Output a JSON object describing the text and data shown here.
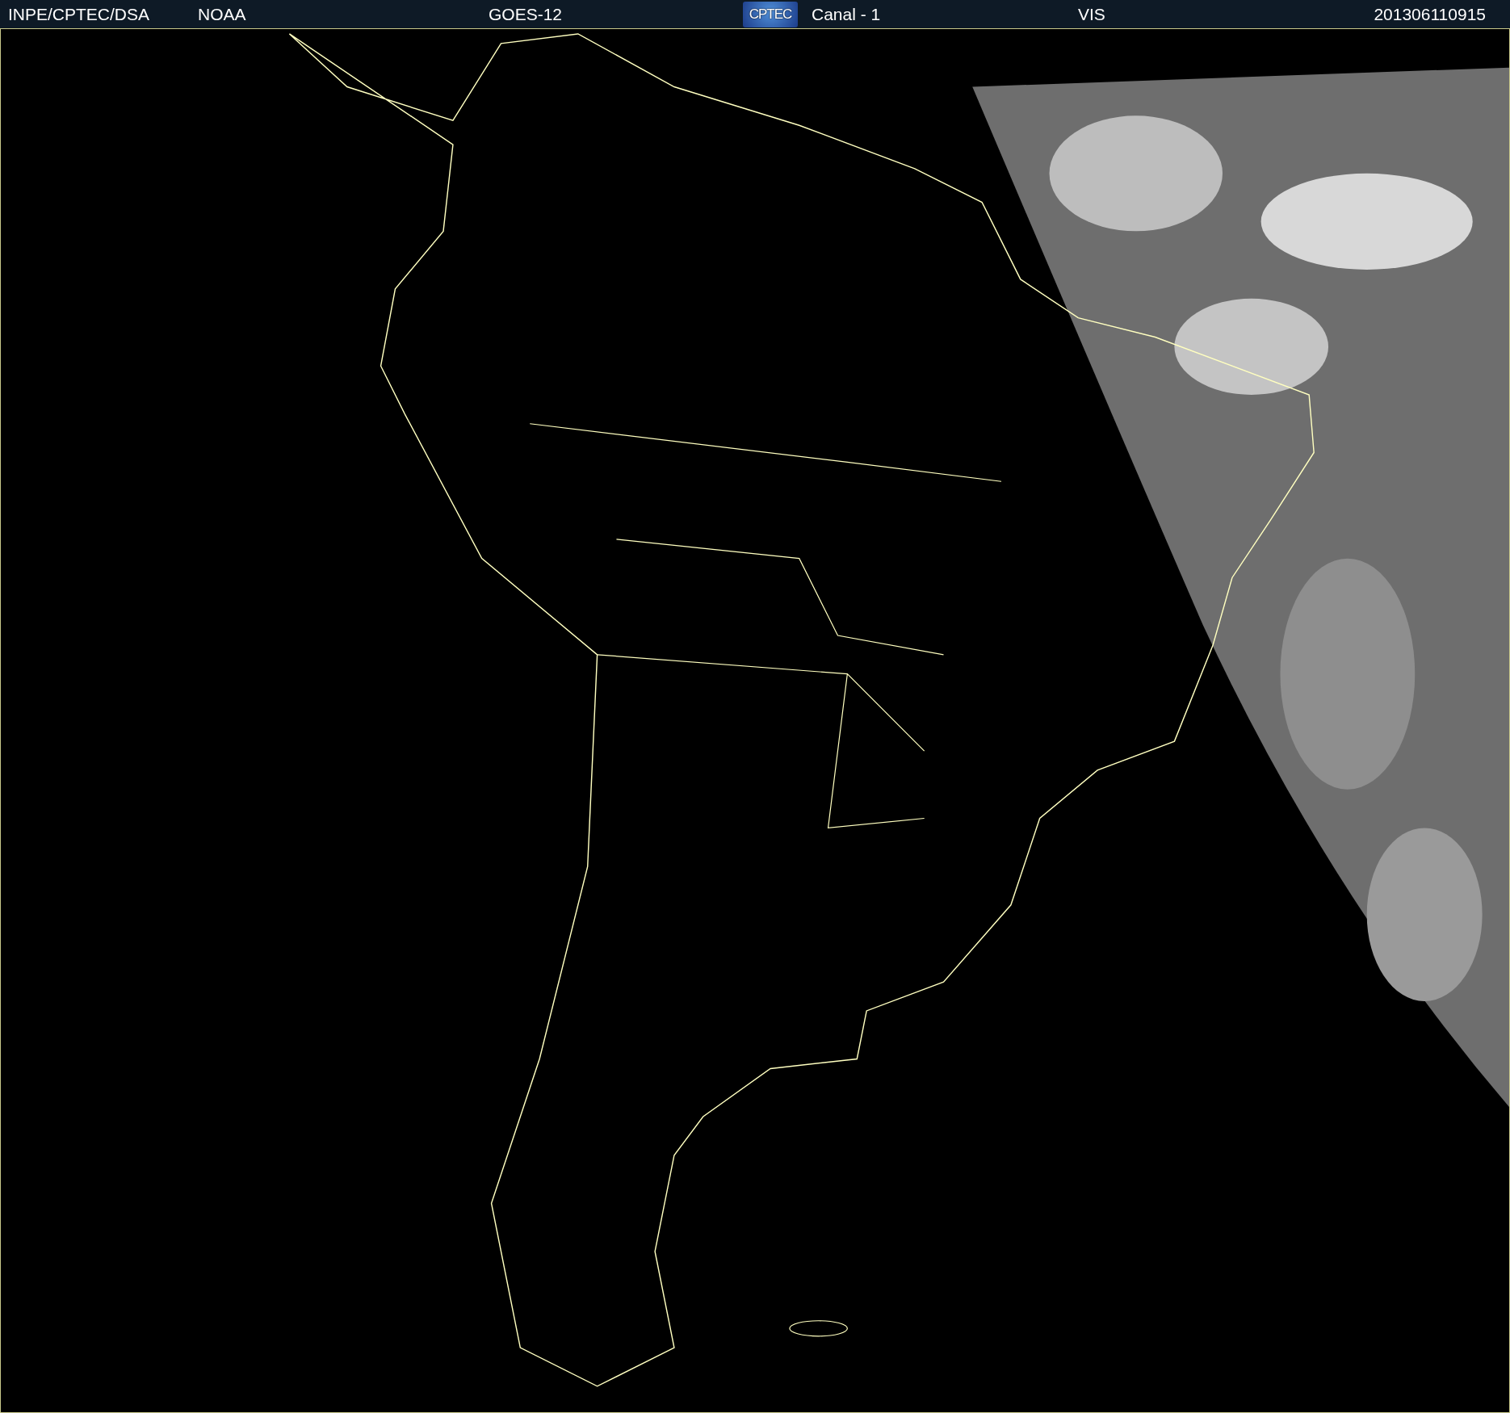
{
  "header": {
    "source": "INPE/CPTEC/DSA",
    "agency": "NOAA",
    "satellite": "GOES-12",
    "logo": "CPTEC",
    "channel": "Canal - 1",
    "band": "VIS",
    "timestamp": "201306110915"
  }
}
